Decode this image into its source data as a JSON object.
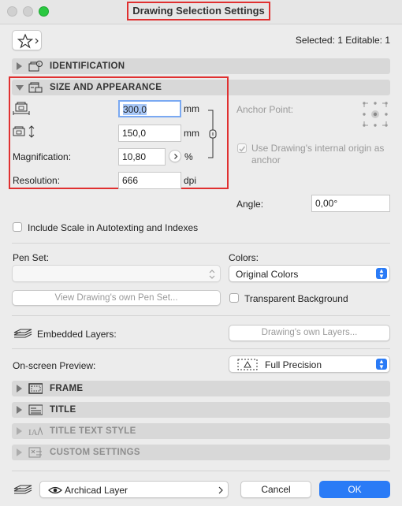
{
  "window": {
    "title": "Drawing Selection Settings"
  },
  "header": {
    "selected_text": "Selected: 1 Editable: 1"
  },
  "panels": {
    "identification": "IDENTIFICATION",
    "size_appearance": "SIZE AND APPEARANCE",
    "frame": "FRAME",
    "title": "TITLE",
    "title_text_style": "TITLE TEXT STYLE",
    "custom_settings": "CUSTOM SETTINGS"
  },
  "size": {
    "width_value": "300,0",
    "width_unit": "mm",
    "height_value": "150,0",
    "height_unit": "mm",
    "magnification_label": "Magnification:",
    "magnification_value": "10,80",
    "magnification_unit": "%",
    "resolution_label": "Resolution:",
    "resolution_value": "666",
    "resolution_unit": "dpi",
    "anchor_point_label": "Anchor Point:",
    "use_origin_label": "Use Drawing's internal origin as anchor",
    "angle_label": "Angle:",
    "angle_value": "0,00°"
  },
  "options": {
    "include_scale_label": "Include Scale in Autotexting and Indexes",
    "pen_set_label": "Pen Set:",
    "pen_set_value": "",
    "view_pen_set_button": "View Drawing's own Pen Set...",
    "colors_label": "Colors:",
    "colors_value": "Original Colors",
    "transparent_bg_label": "Transparent Background",
    "embedded_layers_label": "Embedded Layers:",
    "drawing_layers_button": "Drawing's own Layers...",
    "onscreen_preview_label": "On-screen Preview:",
    "onscreen_preview_value": "Full Precision"
  },
  "footer": {
    "layer_value": "Archicad Layer",
    "cancel_label": "Cancel",
    "ok_label": "OK"
  },
  "colors": {
    "accent": "#2a7bf6",
    "highlight": "#e03030"
  }
}
